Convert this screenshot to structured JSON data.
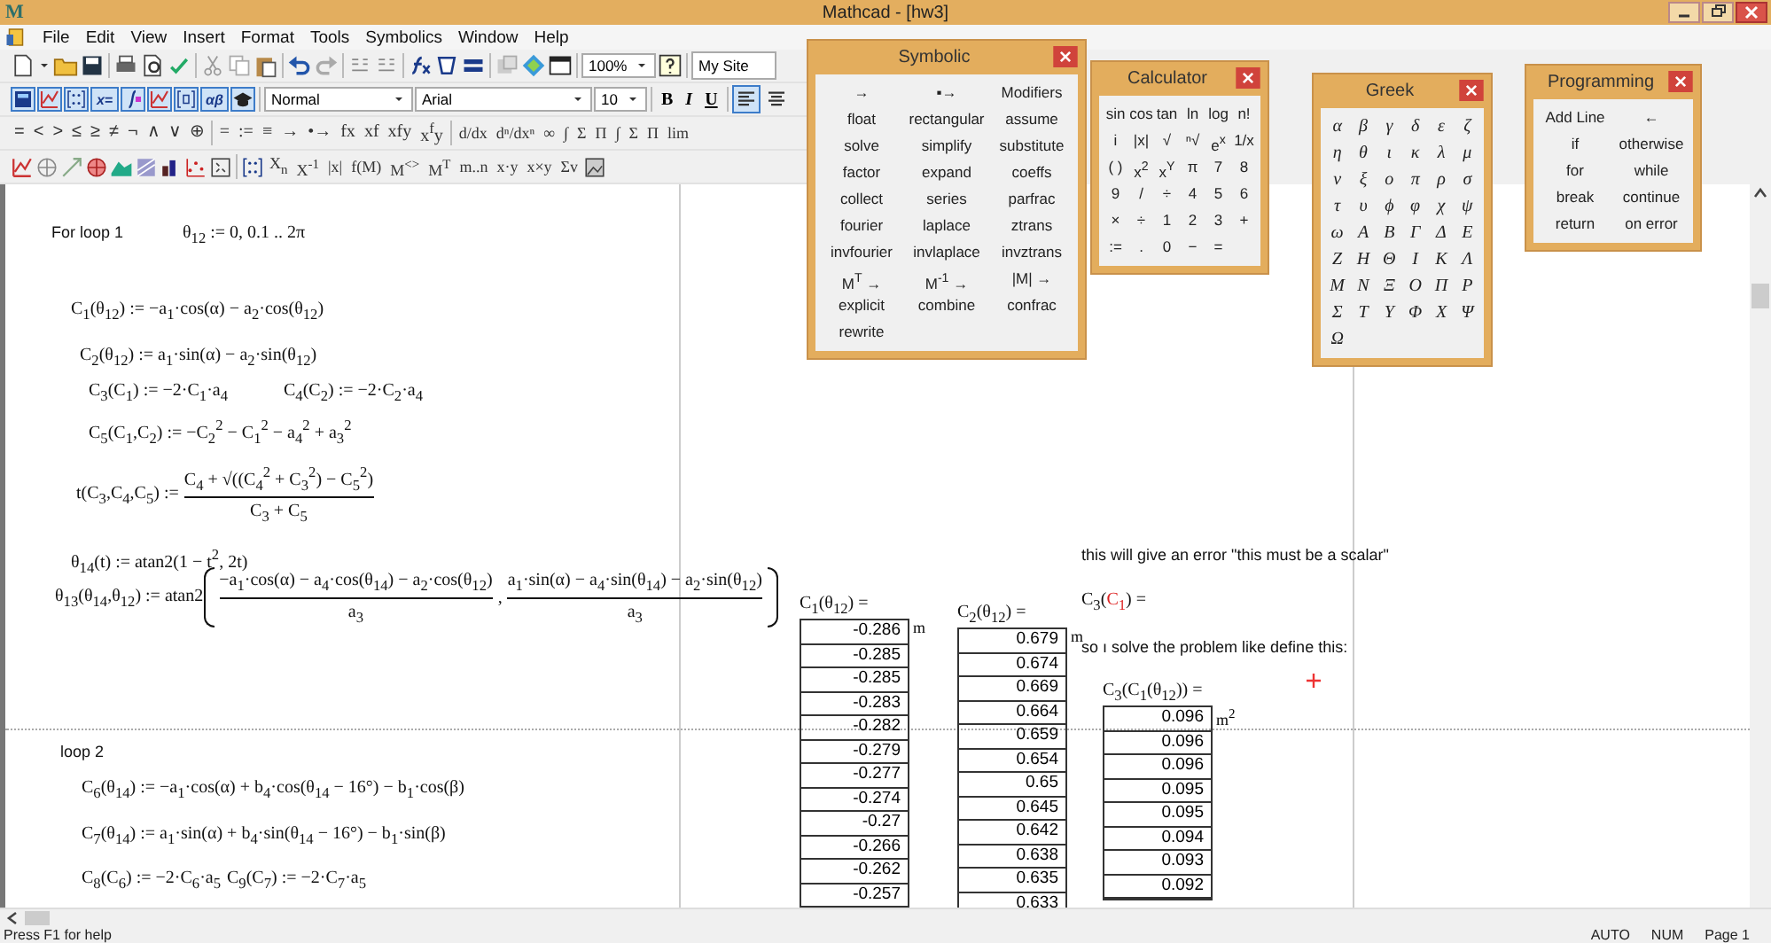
{
  "window": {
    "logo": "M",
    "title": "Mathcad - [hw3]"
  },
  "menu": [
    "File",
    "Edit",
    "View",
    "Insert",
    "Format",
    "Tools",
    "Symbolics",
    "Window",
    "Help"
  ],
  "toolbar": {
    "zoom": "100%",
    "site": "My Site",
    "style": "Normal",
    "font": "Arial",
    "size": "10",
    "format_buttons": [
      "B",
      "I",
      "U"
    ],
    "align_buttons": [
      {
        "selected": true
      },
      {
        "selected": false
      }
    ],
    "palette_labels": [
      "x=",
      "αβ"
    ],
    "boolean": [
      "=",
      "<",
      ">",
      "≤",
      "≥",
      "≠",
      "¬",
      "∧",
      "∨",
      "⊕"
    ],
    "evaluation": [
      "=",
      ":=",
      "≡",
      "→",
      "•→",
      "fx",
      "xf",
      "xfy",
      "x$^{f}$y"
    ],
    "calculus": [
      "d/dx",
      "dⁿ/dxⁿ",
      "∞",
      "∫",
      "Σ",
      "Π",
      "∫",
      "Σ",
      "Π",
      "lim"
    ],
    "matrix": [
      "X$_{n}$",
      "X$^{-1}$",
      "|x|",
      "f(M)",
      "M$^{<>}$",
      "M$^{T}$",
      "m..n",
      "x·y",
      "x×y",
      "Σv"
    ]
  },
  "palettes": [
    {
      "kind": "symbolic",
      "title": "Symbolic",
      "items": [
        "→",
        "▪→",
        "Modifiers",
        "float",
        "rectangular",
        "assume",
        "solve",
        "simplify",
        "substitute",
        "factor",
        "expand",
        "coeffs",
        "collect",
        "series",
        "parfrac",
        "fourier",
        "laplace",
        "ztrans",
        "invfourier",
        "invlaplace",
        "invztrans",
        "M$^{T}$ →",
        "M$^{-1}$ →",
        "|M| →",
        "explicit",
        "combine",
        "confrac",
        "rewrite"
      ]
    },
    {
      "kind": "calculator",
      "title": "Calculator",
      "items": [
        "sin",
        "cos",
        "tan",
        "ln",
        "log",
        "n!",
        "i",
        "|x|",
        "√",
        "ⁿ√",
        "e$^{x}$",
        "1/x",
        "( )",
        "x$^{2}$",
        "x$^{Y}$",
        "π",
        "7",
        "8",
        "9",
        "/",
        "÷",
        "4",
        "5",
        "6",
        "×",
        "÷",
        "1",
        "2",
        "3",
        "+",
        ":=",
        ".",
        "0",
        "−",
        "="
      ]
    },
    {
      "kind": "greek",
      "title": "Greek",
      "items": [
        "α",
        "β",
        "γ",
        "δ",
        "ε",
        "ζ",
        "η",
        "θ",
        "ι",
        "κ",
        "λ",
        "μ",
        "ν",
        "ξ",
        "ο",
        "π",
        "ρ",
        "σ",
        "τ",
        "υ",
        "ϕ",
        "φ",
        "χ",
        "ψ",
        "ω",
        "Α",
        "Β",
        "Γ",
        "Δ",
        "Ε",
        "Ζ",
        "Η",
        "Θ",
        "Ι",
        "Κ",
        "Λ",
        "Μ",
        "Ν",
        "Ξ",
        "Ο",
        "Π",
        "Ρ",
        "Σ",
        "Τ",
        "Υ",
        "Φ",
        "Χ",
        "Ψ",
        "Ω"
      ]
    },
    {
      "kind": "programming",
      "title": "Programming",
      "items": [
        "Add Line",
        "←",
        "if",
        "otherwise",
        "for",
        "while",
        "break",
        "continue",
        "return",
        "on error"
      ]
    }
  ],
  "worksheet": {
    "regions": [
      {
        "kind": "text",
        "text": "For loop 1"
      },
      {
        "kind": "expr",
        "text": "θ$_{12}$ := 0, 0.1 .. 2π"
      },
      {
        "kind": "expr",
        "text": "C$_{1}$(θ$_{12}$) := −a$_{1}$·cos(α) − a$_{2}$·cos(θ$_{12}$)"
      },
      {
        "kind": "expr",
        "text": "C$_{2}$(θ$_{12}$) := a$_{1}$·sin(α) − a$_{2}$·sin(θ$_{12}$)"
      },
      {
        "kind": "expr",
        "text": "C$_{3}$(C$_{1}$) := −2·C$_{1}$·a$_{4}$"
      },
      {
        "kind": "expr",
        "text": "C$_{4}$(C$_{2}$) := −2·C$_{2}$·a$_{4}$"
      },
      {
        "kind": "expr",
        "text": "C$_{5}$(C$_{1}$,C$_{2}$) := −C$_{2}$$^{2}$ − C$_{1}$$^{2}$ − a$_{4}$$^{2}$ + a$_{3}$$^{2}$"
      },
      {
        "kind": "fraction",
        "lhs": "t(C$_{3}$,C$_{4}$,C$_{5}$) :=",
        "numerator": "C$_{4}$ + √((C$_{4}$$^{2}$ + C$_{3}$$^{2}$) − C$_{5}$$^{2}$)",
        "denominator": "C$_{3}$ + C$_{5}$"
      },
      {
        "kind": "expr",
        "text": "θ$_{14}$(t) := atan2(1 − t$^{2}$, 2t)"
      },
      {
        "kind": "atan2",
        "lhs": "θ$_{13}$(θ$_{14}$,θ$_{12}$) := atan2",
        "separator": ",",
        "fractions": [
          {
            "numerator": "−a$_{1}$·cos(α) − a$_{4}$·cos(θ$_{14}$) − a$_{2}$·cos(θ$_{12}$)",
            "denominator": "a$_{3}$"
          },
          {
            "numerator": "a$_{1}$·sin(α) − a$_{4}$·sin(θ$_{14}$) − a$_{2}$·sin(θ$_{12}$)",
            "denominator": "a$_{3}$"
          }
        ]
      },
      {
        "kind": "table",
        "label": "C$_{1}$(θ$_{12}$) =",
        "unit": "m",
        "values": [
          "-0.286",
          "-0.285",
          "-0.285",
          "-0.283",
          "-0.282",
          "-0.279",
          "-0.277",
          "-0.274",
          "-0.27",
          "-0.266",
          "-0.262",
          "-0.257"
        ]
      },
      {
        "kind": "table",
        "label": "C$_{2}$(θ$_{12}$) =",
        "unit": "m",
        "values": [
          "0.679",
          "0.674",
          "0.669",
          "0.664",
          "0.659",
          "0.654",
          "0.65",
          "0.645",
          "0.642",
          "0.638",
          "0.635",
          "0.633"
        ]
      },
      {
        "kind": "text",
        "text": "this will give an error \"this must be a scalar\""
      },
      {
        "kind": "error",
        "before": "C$_{3}$(",
        "error": "C$_{1}$",
        "after": ") ="
      },
      {
        "kind": "text",
        "text": "so ı solve the problem like define this:"
      },
      {
        "kind": "table",
        "label": "C$_{3}$(C$_{1}$(θ$_{12}$)) =",
        "unit": "m$^{2}$",
        "values": [
          "0.096",
          "0.096",
          "0.096",
          "0.095",
          "0.095",
          "0.094",
          "0.093",
          "0.092"
        ]
      },
      {
        "kind": "text",
        "text": "loop 2"
      },
      {
        "kind": "expr",
        "text": "C$_{6}$(θ$_{14}$) := −a$_{1}$·cos(α) + b$_{4}$·cos(θ$_{14}$ − 16°) − b$_{1}$·cos(β)"
      },
      {
        "kind": "expr",
        "text": "C$_{7}$(θ$_{14}$) := a$_{1}$·sin(α) + b$_{4}$·sin(θ$_{14}$ − 16°) − b$_{1}$·sin(β)"
      },
      {
        "kind": "expr",
        "text": "C$_{8}$(C$_{6}$) := −2·C$_{6}$·a$_{5}$"
      },
      {
        "kind": "expr",
        "text": "C$_{9}$(C$_{7}$) := −2·C$_{7}$·a$_{5}$"
      }
    ]
  },
  "status_bar": {
    "help": "Press F1 for help",
    "indicators": [
      "AUTO",
      "NUM",
      "Page 1"
    ]
  }
}
